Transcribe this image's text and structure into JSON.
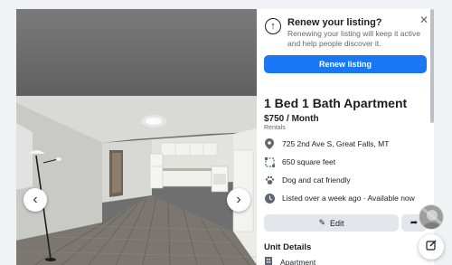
{
  "listing_notice": {
    "title": "Renew your listing?",
    "text": "Renewing your listing will keep it active and help people discover it.",
    "button": "Renew listing"
  },
  "listing": {
    "title": "1 Bed 1 Bath Apartment",
    "price": "$750 / Month",
    "category": "Rentals",
    "details": [
      {
        "icon": "location-pin-icon",
        "text": "725 2nd Ave S, Great Falls, MT"
      },
      {
        "icon": "square-feet-icon",
        "text": "650 square feet"
      },
      {
        "icon": "paw-icon",
        "text": "Dog and cat friendly"
      },
      {
        "icon": "clock-icon",
        "text": "Listed over a week ago · Available now"
      }
    ]
  },
  "actions": {
    "edit_label": "Edit"
  },
  "unit_details": {
    "title": "Unit Details",
    "type": "Apartment"
  },
  "colors": {
    "accent": "#1877f2",
    "button_gray": "#e4e6eb"
  }
}
